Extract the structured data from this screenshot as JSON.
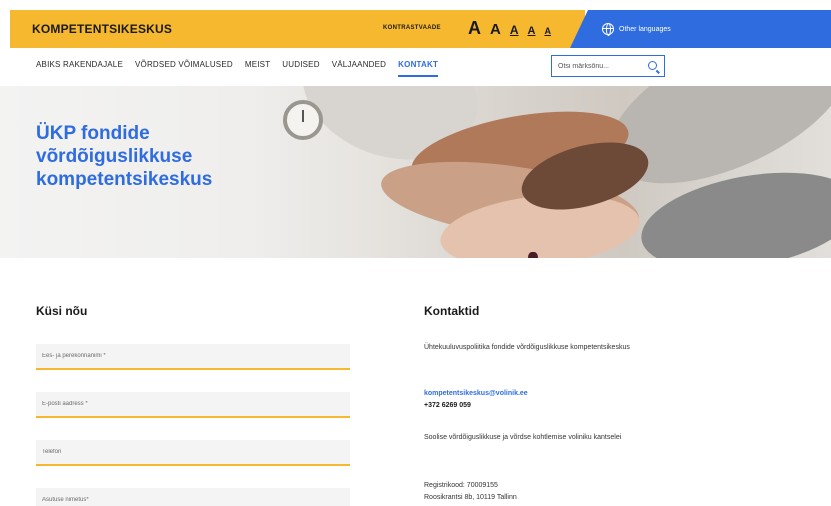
{
  "header": {
    "brand": "KOMPETENTSIKESKUS",
    "contrast_label": "KONTRASTVAADE",
    "font_sizes": [
      "A",
      "A",
      "A",
      "A",
      "A"
    ],
    "languages_label": "Other languages",
    "accent_color": "#f5b82e",
    "lang_color": "#2f6ce0",
    "globe_icon": "globe-icon"
  },
  "nav": {
    "items": [
      {
        "label": "ABIKS RAKENDAJALE"
      },
      {
        "label": "VÕRDSED VÕIMALUSED"
      },
      {
        "label": "MEIST"
      },
      {
        "label": "UUDISED"
      },
      {
        "label": "VÄLJAANDED"
      },
      {
        "label": "KONTAKT"
      }
    ],
    "active": "KONTAKT",
    "search_placeholder": "Otsi märksõnu...",
    "search_icon": "search-icon"
  },
  "hero": {
    "title": "ÜKP fondide võrdõiguslikkuse kompetentsikeskus"
  },
  "form": {
    "title": "Küsi nõu",
    "fields": [
      {
        "placeholder": "Ees- ja perekonnanimi *"
      },
      {
        "placeholder": "E-posti aadress *"
      },
      {
        "placeholder": "Telefon"
      },
      {
        "placeholder": "Asutuse nimetus*"
      }
    ]
  },
  "contacts": {
    "title": "Kontaktid",
    "org": "Ühtekuuluvuspoliitika fondide võrdõiguslikkuse kompetentsikeskus",
    "email": "kompetentsikeskus@volinik.ee",
    "phone": "+372 6269 059",
    "office": "Soolise võrdõiguslikkuse ja võrdse kohtlemise voliniku kantselei",
    "reg": "Registrikood: 70009155",
    "address": "Roosikrantsi 8b, 10119 Tallinn"
  }
}
